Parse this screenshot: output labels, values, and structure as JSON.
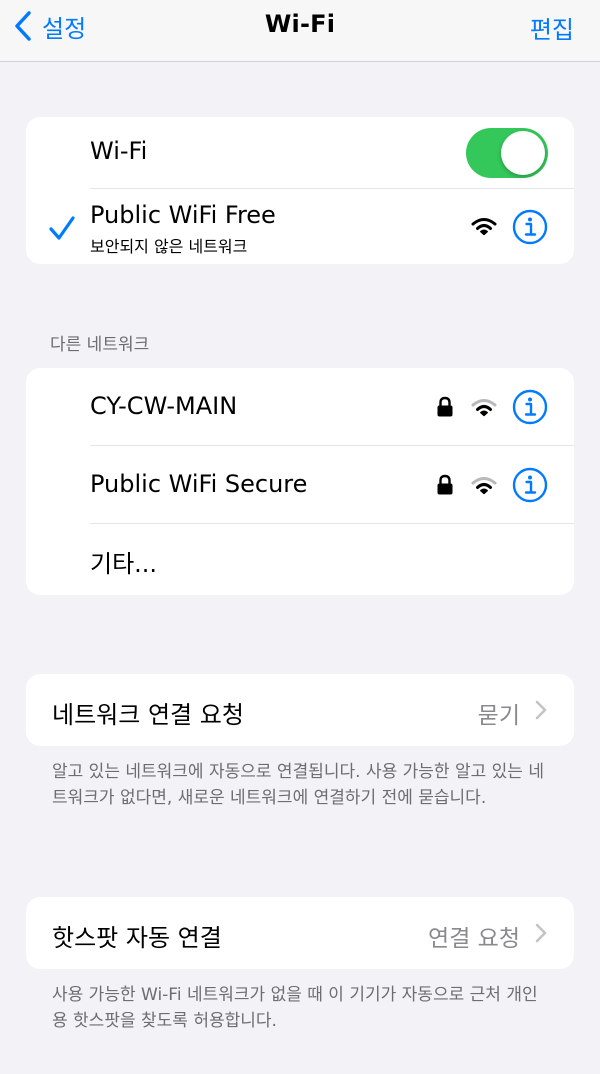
{
  "nav": {
    "back_label": "설정",
    "title": "Wi-Fi",
    "edit_label": "편집"
  },
  "current": {
    "wifi_label": "Wi-Fi",
    "wifi_on": true,
    "network_name": "Public WiFi Free",
    "network_sub": "보안되지 않은 네트워크"
  },
  "other": {
    "header": "다른 네트워크",
    "networks": [
      {
        "name": "CY-CW-MAIN",
        "secured": true
      },
      {
        "name": "Public WiFi Secure",
        "secured": true
      }
    ],
    "other_label": "기타..."
  },
  "ask_join": {
    "label": "네트워크 연결 요청",
    "value": "묻기",
    "footer": "알고 있는 네트워크에 자동으로 연결됩니다. 사용 가능한 알고 있는 네트워크가 없다면, 새로운 네트워크에 연결하기 전에 묻습니다."
  },
  "hotspot": {
    "label": "핫스팟 자동 연결",
    "value": "연결 요청",
    "footer": "사용 가능한 Wi-Fi 네트워크가 없을 때 이 기기가 자동으로 근처 개인용 핫스팟을 찾도록 허용합니다."
  },
  "colors": {
    "accent": "#007aff",
    "toggle_on": "#34c759",
    "background": "#f2f2f7"
  }
}
